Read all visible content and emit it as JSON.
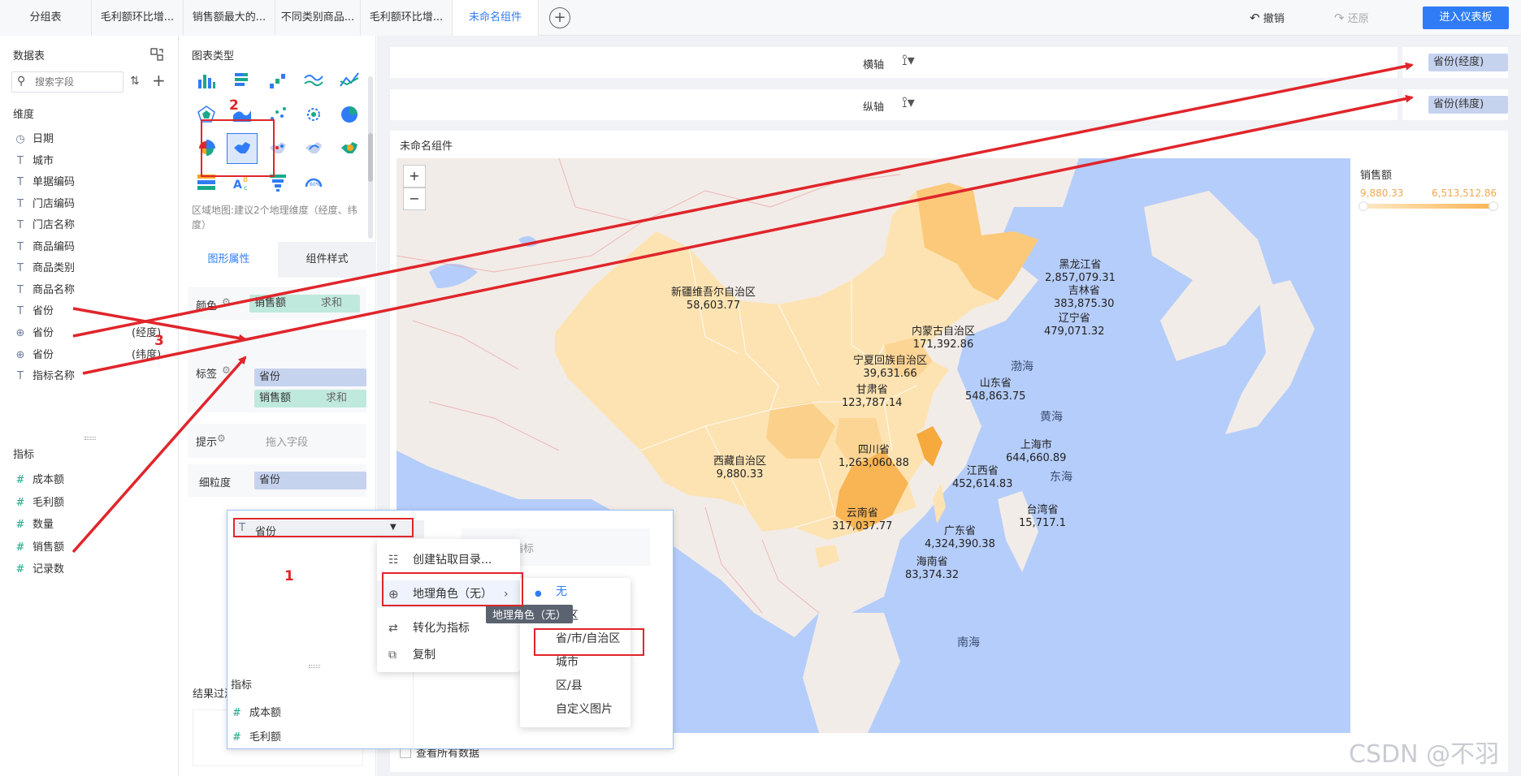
{
  "tabs": [
    {
      "label": "分组表",
      "active": false
    },
    {
      "label": "毛利额环比增...",
      "active": false
    },
    {
      "label": "销售额最大的...",
      "active": false
    },
    {
      "label": "不同类别商品...",
      "active": false
    },
    {
      "label": "毛利额环比增...",
      "active": false
    },
    {
      "label": "未命名组件",
      "active": true
    }
  ],
  "toolbar": {
    "undo": "撤销",
    "redo": "还原",
    "enter_dashboard": "进入仪表板"
  },
  "left": {
    "data_table": "数据表",
    "search_placeholder": "搜索字段",
    "dimension_label": "维度",
    "dimensions": [
      {
        "label": "日期",
        "icon": "clock-icon",
        "suffix": ""
      },
      {
        "label": "城市",
        "icon": "text-icon",
        "suffix": ""
      },
      {
        "label": "单据编码",
        "icon": "text-icon",
        "suffix": ""
      },
      {
        "label": "门店编码",
        "icon": "text-icon",
        "suffix": ""
      },
      {
        "label": "门店名称",
        "icon": "text-icon",
        "suffix": ""
      },
      {
        "label": "商品编码",
        "icon": "text-icon",
        "suffix": ""
      },
      {
        "label": "商品类别",
        "icon": "text-icon",
        "suffix": ""
      },
      {
        "label": "商品名称",
        "icon": "text-icon",
        "suffix": ""
      },
      {
        "label": "省份",
        "icon": "text-icon",
        "suffix": ""
      },
      {
        "label": "省份",
        "icon": "globe-icon",
        "suffix": "(经度)"
      },
      {
        "label": "省份",
        "icon": "globe-icon",
        "suffix": "(纬度)"
      },
      {
        "label": "指标名称",
        "icon": "text-icon",
        "suffix": ""
      }
    ],
    "measure_label": "指标",
    "measures": [
      "成本额",
      "毛利额",
      "数量",
      "销售额",
      "记录数"
    ]
  },
  "chart_panel": {
    "title": "图表类型",
    "hint": "区域地图:建议2个地理维度（经度、纬度）",
    "tab_shape": "图形属性",
    "tab_style": "组件样式",
    "color_label": "颜色",
    "color_field": "销售额",
    "color_agg": "求和",
    "label_label": "标签",
    "label_field1": "省份",
    "label_field2": "销售额",
    "label_agg": "求和",
    "tooltip_label": "提示",
    "tooltip_placeholder": "拖入字段",
    "granularity_label": "细粒度",
    "granularity_field": "省份",
    "result_filter": "结果过滤"
  },
  "axes": {
    "x_label": "横轴",
    "y_label": "纵轴",
    "x_field": "省份(经度)",
    "y_field": "省份(纬度)"
  },
  "widget": {
    "title": "未命名组件",
    "legend_title": "销售额",
    "legend_min": "9,880.33",
    "legend_max": "6,513,512.86",
    "show_all": "查看所有数据",
    "zoom_in": "+",
    "zoom_out": "−"
  },
  "map_labels": [
    {
      "name": "新疆维吾尔自治区",
      "value": "58,603.77"
    },
    {
      "name": "黑龙江省",
      "value": "2,857,079.31"
    },
    {
      "name": "吉林省",
      "value": "383,875.30"
    },
    {
      "name": "辽宁省",
      "value": "479,071.32"
    },
    {
      "name": "内蒙古自治区",
      "value": "171,392.86"
    },
    {
      "name": "宁夏回族自治区",
      "value": "39,631.66"
    },
    {
      "name": "甘肃省",
      "value": "123,787.14"
    },
    {
      "name": "山东省",
      "value": "548,863.75"
    },
    {
      "name": "四川省",
      "value": "1,263,060.88"
    },
    {
      "name": "上海市",
      "value": "644,660.89"
    },
    {
      "name": "西藏自治区",
      "value": "9,880.33"
    },
    {
      "name": "江西省",
      "value": "452,614.83"
    },
    {
      "name": "台湾省",
      "value": "15,717.1"
    },
    {
      "name": "云南省",
      "value": "317,037.77"
    },
    {
      "name": "广东省",
      "value": "4,324,390.38"
    },
    {
      "name": "海南省",
      "value": "83,374.32"
    }
  ],
  "seas": [
    "渤海",
    "黄海",
    "东海",
    "南海"
  ],
  "popup": {
    "field": "省份",
    "bg_text": "个指标",
    "measures_label": "指标",
    "measures": [
      "成本额",
      "毛利额"
    ],
    "menu": [
      "创建钻取目录...",
      "地理角色（无）",
      "转化为指标",
      "复制"
    ],
    "tooltip": "地理角色（无）",
    "geo_options": [
      "无",
      "地区",
      "省/市/自治区",
      "城市",
      "区/县",
      "自定义图片"
    ]
  },
  "annotations": {
    "step1": "1",
    "step2": "2",
    "step3": "3"
  },
  "watermark": "CSDN @不羽",
  "colors": {
    "accent": "#2f7cf6",
    "map_light": "#fde3b2",
    "map_dark": "#f9b454",
    "sea": "#b5cdfa",
    "annotation": "#e0252b"
  }
}
